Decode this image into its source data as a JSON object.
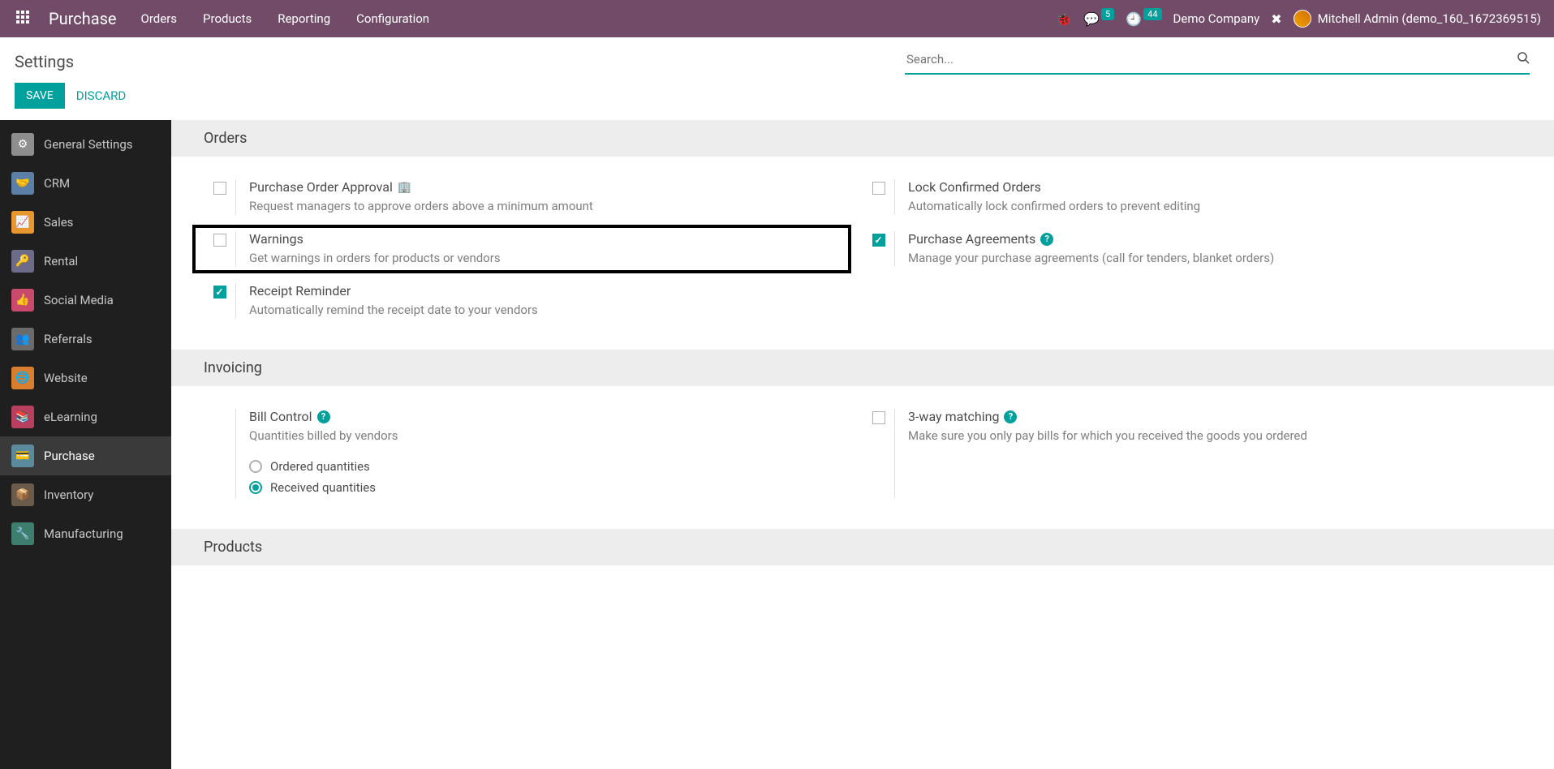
{
  "navbar": {
    "brand": "Purchase",
    "menu": [
      "Orders",
      "Products",
      "Reporting",
      "Configuration"
    ],
    "messages_badge": "5",
    "activities_badge": "44",
    "company": "Demo Company",
    "user": "Mitchell Admin (demo_160_1672369515)"
  },
  "header": {
    "title": "Settings",
    "search_placeholder": "Search...",
    "save_label": "SAVE",
    "discard_label": "DISCARD"
  },
  "sidebar": {
    "items": [
      {
        "label": "General Settings"
      },
      {
        "label": "CRM"
      },
      {
        "label": "Sales"
      },
      {
        "label": "Rental"
      },
      {
        "label": "Social Media"
      },
      {
        "label": "Referrals"
      },
      {
        "label": "Website"
      },
      {
        "label": "eLearning"
      },
      {
        "label": "Purchase"
      },
      {
        "label": "Inventory"
      },
      {
        "label": "Manufacturing"
      }
    ]
  },
  "sections": {
    "orders": {
      "heading": "Orders",
      "settings": [
        {
          "title": "Purchase Order Approval",
          "desc": "Request managers to approve orders above a minimum amount",
          "checked": false
        },
        {
          "title": "Lock Confirmed Orders",
          "desc": "Automatically lock confirmed orders to prevent editing",
          "checked": false
        },
        {
          "title": "Warnings",
          "desc": "Get warnings in orders for products or vendors",
          "checked": false
        },
        {
          "title": "Purchase Agreements",
          "desc": "Manage your purchase agreements (call for tenders, blanket orders)",
          "checked": true
        },
        {
          "title": "Receipt Reminder",
          "desc": "Automatically remind the receipt date to your vendors",
          "checked": true
        }
      ]
    },
    "invoicing": {
      "heading": "Invoicing",
      "bill_control": {
        "title": "Bill Control",
        "desc": "Quantities billed by vendors",
        "options": [
          {
            "label": "Ordered quantities",
            "selected": false
          },
          {
            "label": "Received quantities",
            "selected": true
          }
        ]
      },
      "three_way": {
        "title": "3-way matching",
        "desc": "Make sure you only pay bills for which you received the goods you ordered",
        "checked": false
      }
    },
    "products": {
      "heading": "Products"
    }
  }
}
